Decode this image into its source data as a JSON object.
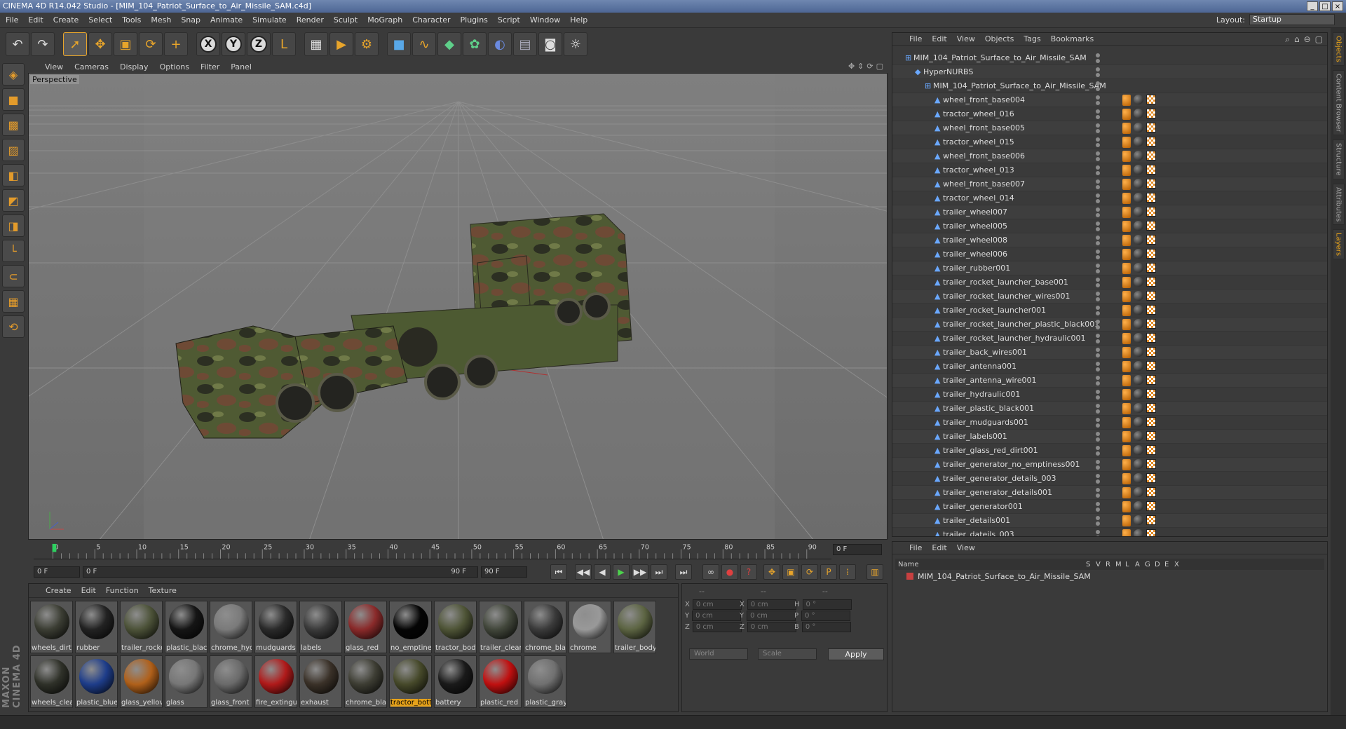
{
  "app": {
    "title": "CINEMA 4D R14.042 Studio - [MIM_104_Patriot_Surface_to_Air_Missile_SAM.c4d]",
    "window_controls": [
      "_",
      "□",
      "×"
    ]
  },
  "menu": [
    "File",
    "Edit",
    "Create",
    "Select",
    "Tools",
    "Mesh",
    "Snap",
    "Animate",
    "Simulate",
    "Render",
    "Sculpt",
    "MoGraph",
    "Character",
    "Plugins",
    "Script",
    "Window",
    "Help"
  ],
  "layout": {
    "label": "Layout:",
    "value": "Startup"
  },
  "toolbar": {
    "undo_icon": "↶",
    "redo_icon": "↷",
    "select_icon": "➚",
    "move_icon": "✥",
    "scale_icon": "▣",
    "rotate_icon": "⟳",
    "plus_icon": "+",
    "x_axis": "X",
    "y_axis": "Y",
    "z_axis": "Z",
    "world_icon": "L",
    "render_region": "▦",
    "render_view": "▶",
    "render_settings": "⚙",
    "cube_icon": "■",
    "spline_icon": "∿",
    "nurbs_icon": "◆",
    "array_icon": "✿",
    "deformer_icon": "◐",
    "floor_icon": "▤",
    "camera_icon": "◙",
    "light_icon": "☼"
  },
  "left_tools": [
    "◈",
    "■",
    "▩",
    "▨",
    "◧",
    "◩",
    "◨",
    "└",
    "⊂",
    "▦",
    "⟲"
  ],
  "maxon_label": "MAXON CINEMA 4D",
  "viewport": {
    "menu": [
      "View",
      "Cameras",
      "Display",
      "Options",
      "Filter",
      "Panel"
    ],
    "nav_icons": [
      "✥",
      "⇕",
      "⟳",
      "▢"
    ],
    "label": "Perspective"
  },
  "timeline": {
    "ticks": [
      "0",
      "5",
      "10",
      "15",
      "20",
      "25",
      "30",
      "35",
      "40",
      "45",
      "50",
      "55",
      "60",
      "65",
      "70",
      "75",
      "80",
      "85",
      "90"
    ],
    "current": "0 F"
  },
  "transport": {
    "start_field": "0 F",
    "range_start": "0 F",
    "range_end": "90 F",
    "end_field": "90 F",
    "buttons": [
      "⏮",
      "◀◀",
      "◀",
      "▶",
      "▶▶",
      "⏭",
      "⏭"
    ]
  },
  "materials": {
    "menu": [
      "Create",
      "Edit",
      "Function",
      "Texture"
    ],
    "items": [
      {
        "name": "wheels_dirt",
        "color": "#3b3d33"
      },
      {
        "name": "rubber",
        "color": "#222222"
      },
      {
        "name": "trailer_rocke",
        "color": "#4c5238"
      },
      {
        "name": "plastic_black",
        "color": "#151515"
      },
      {
        "name": "chrome_hyd",
        "color": "#7a7a7a"
      },
      {
        "name": "mudguards",
        "color": "#2a2a2a"
      },
      {
        "name": "labels",
        "color": "#3a3a3a"
      },
      {
        "name": "glass_red",
        "color": "#8a2a2a"
      },
      {
        "name": "no_emptine",
        "color": "#050505"
      },
      {
        "name": "tractor_bod",
        "color": "#4e5436"
      },
      {
        "name": "trailer_clear",
        "color": "#41463a"
      },
      {
        "name": "chrome_blac",
        "color": "#3a3a3a"
      },
      {
        "name": "chrome",
        "color": "#999999"
      },
      {
        "name": "trailer_body",
        "color": "#5c6442"
      },
      {
        "name": "wheels_clea",
        "color": "#2f3129"
      },
      {
        "name": "plastic_blue",
        "color": "#1e3d8a"
      },
      {
        "name": "glass_yellov",
        "color": "#b0601a"
      },
      {
        "name": "glass",
        "color": "#777777"
      },
      {
        "name": "glass_front",
        "color": "#6a6a6a"
      },
      {
        "name": "fire_extingu",
        "color": "#b01a1a"
      },
      {
        "name": "exhaust",
        "color": "#3a3128"
      },
      {
        "name": "chrome_blac",
        "color": "#3d3d33"
      },
      {
        "name": "tractor_bott",
        "color": "#46492a"
      },
      {
        "name": "battery",
        "color": "#1a1a1a"
      },
      {
        "name": "plastic_red",
        "color": "#c01010"
      },
      {
        "name": "plastic_gray",
        "color": "#707070"
      }
    ],
    "selected_index": 22
  },
  "coordinates": {
    "header": [
      "--",
      "--",
      "--"
    ],
    "rows": [
      {
        "a": "X",
        "av": "0 cm",
        "b": "X",
        "bv": "0 cm",
        "c": "H",
        "cv": "0 °"
      },
      {
        "a": "Y",
        "av": "0 cm",
        "b": "Y",
        "bv": "0 cm",
        "c": "P",
        "cv": "0 °"
      },
      {
        "a": "Z",
        "av": "0 cm",
        "b": "Z",
        "bv": "0 cm",
        "c": "B",
        "cv": "0 °"
      }
    ],
    "world": "World",
    "scale": "Scale",
    "apply": "Apply"
  },
  "objects": {
    "menu": [
      "File",
      "Edit",
      "View",
      "Objects",
      "Tags",
      "Bookmarks"
    ],
    "icons": [
      "⌕",
      "⌂",
      "⊖",
      "▢"
    ],
    "root": "MIM_104_Patriot_Surface_to_Air_Missile_SAM",
    "hypernurbs": "HyperNURBS",
    "group": "MIM_104_Patriot_Surface_to_Air_Missile_SAM",
    "items": [
      "wheel_front_base004",
      "tractor_wheel_016",
      "wheel_front_base005",
      "tractor_wheel_015",
      "wheel_front_base006",
      "tractor_wheel_013",
      "wheel_front_base007",
      "tractor_wheel_014",
      "trailer_wheel007",
      "trailer_wheel005",
      "trailer_wheel008",
      "trailer_wheel006",
      "trailer_rubber001",
      "trailer_rocket_launcher_base001",
      "trailer_rocket_launcher_wires001",
      "trailer_rocket_launcher001",
      "trailer_rocket_launcher_plastic_black001",
      "trailer_rocket_launcher_hydraulic001",
      "trailer_back_wires001",
      "trailer_antenna001",
      "trailer_antenna_wire001",
      "trailer_hydraulic001",
      "trailer_plastic_black001",
      "trailer_mudguards001",
      "trailer_labels001",
      "trailer_glass_red_dirt001",
      "trailer_generator_no_emptiness001",
      "trailer_generator_details_003",
      "trailer_generator_details001",
      "trailer_generator001",
      "trailer_details001",
      "trailer_dateils_003"
    ]
  },
  "layers": {
    "menu": [
      "File",
      "Edit",
      "View"
    ],
    "columns": [
      "Name",
      "S",
      "V",
      "R",
      "M",
      "L",
      "A",
      "G",
      "D",
      "E",
      "X"
    ],
    "row": "MIM_104_Patriot_Surface_to_Air_Missile_SAM"
  },
  "side_tabs": [
    "Objects",
    "Content Browser",
    "Structure",
    "Attributes",
    "Layers"
  ]
}
